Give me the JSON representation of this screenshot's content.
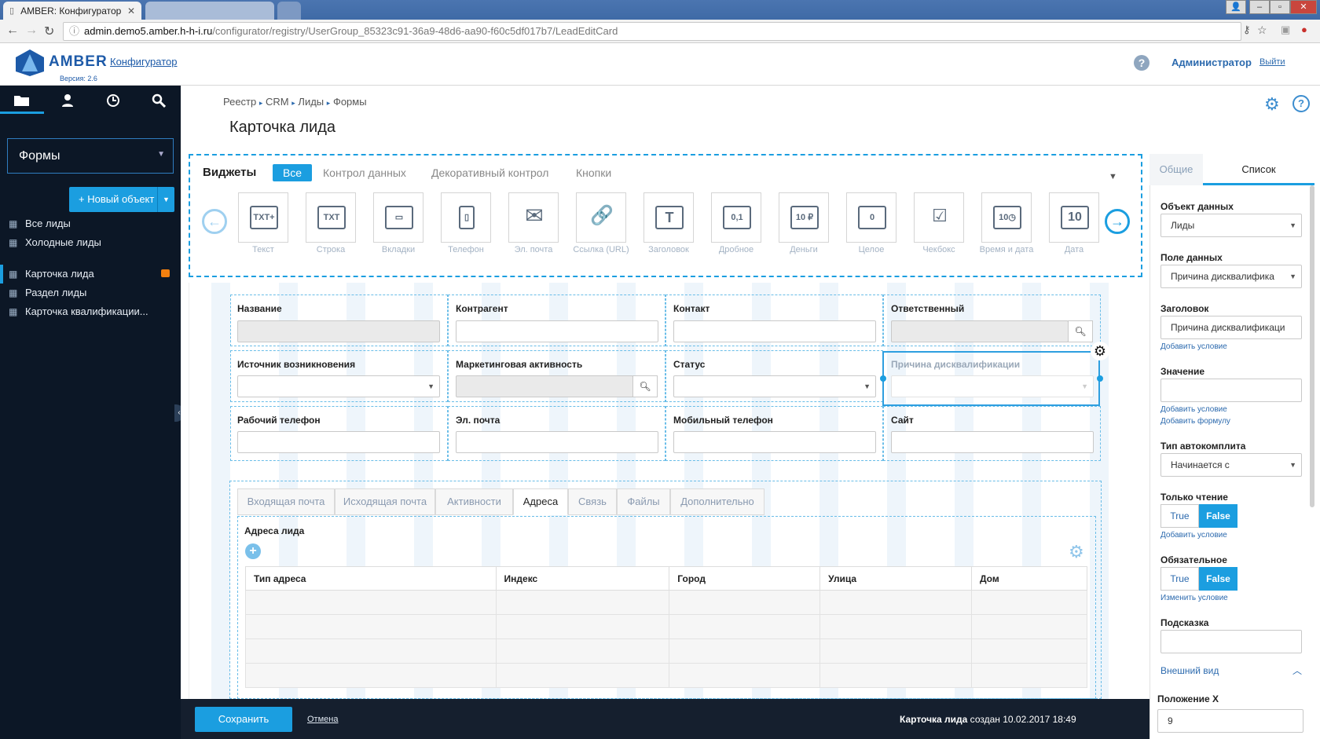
{
  "browser": {
    "tab_title": "AMBER: Конфигуратор",
    "url_host": "admin.demo5.amber.h-h-i.ru",
    "url_path": "/configurator/registry/UserGroup_85323c91-36a9-48d6-aa90-f60c5df017b7/LeadEditCard"
  },
  "header": {
    "logo_text": "AMBER",
    "version": "Версия: 2.6",
    "configurator": "Конфигуратор",
    "user": "Администратор",
    "logout": "Выйти"
  },
  "sidebar": {
    "selected": "Формы",
    "new_object": "+ Новый объект",
    "items": [
      {
        "label": "Все лиды"
      },
      {
        "label": "Холодные лиды"
      },
      {
        "label": "Карточка лида"
      },
      {
        "label": "Раздел лиды"
      },
      {
        "label": "Карточка квалификации..."
      }
    ]
  },
  "breadcrumb": [
    "Реестр",
    "CRM",
    "Лиды",
    "Формы"
  ],
  "page_title": "Карточка лида",
  "widgets": {
    "title": "Виджеты",
    "tabs": [
      "Все",
      "Контрол данных",
      "Декоративный контрол",
      "Кнопки"
    ],
    "items": [
      {
        "label": "Текст",
        "glyph": "TXT+"
      },
      {
        "label": "Строка",
        "glyph": "TXT"
      },
      {
        "label": "Вкладки",
        "glyph": "▭"
      },
      {
        "label": "Телефон",
        "glyph": "▯"
      },
      {
        "label": "Эл. почта",
        "glyph": "✉"
      },
      {
        "label": "Ссылка (URL)",
        "glyph": "🔗"
      },
      {
        "label": "Заголовок",
        "glyph": "T"
      },
      {
        "label": "Дробное",
        "glyph": "0,1"
      },
      {
        "label": "Деньги",
        "glyph": "10 ₽"
      },
      {
        "label": "Целое",
        "glyph": "0"
      },
      {
        "label": "Чекбокс",
        "glyph": "☑"
      },
      {
        "label": "Время и дата",
        "glyph": "10◷"
      },
      {
        "label": "Дата",
        "glyph": "10"
      }
    ]
  },
  "form": {
    "row1": [
      "Название",
      "Контрагент",
      "Контакт",
      "Ответственный"
    ],
    "row2": [
      "Источник возникновения",
      "Маркетинговая активность",
      "Статус",
      "Причина дисквалификации"
    ],
    "row3": [
      "Рабочий телефон",
      "Эл. почта",
      "Мобильный телефон",
      "Сайт"
    ]
  },
  "tabs": {
    "items": [
      "Входящая почта",
      "Исходящая почта",
      "Активности",
      "Адреса",
      "Связь",
      "Файлы",
      "Дополнительно"
    ],
    "section_title": "Адреса лида",
    "columns": [
      "Тип адреса",
      "Индекс",
      "Город",
      "Улица",
      "Дом"
    ]
  },
  "right_panel": {
    "tab_general": "Общие",
    "tab_list": "Список",
    "data_object_label": "Объект данных",
    "data_object_value": "Лиды",
    "data_field_label": "Поле данных",
    "data_field_value": "Причина дисквалифика",
    "heading_label": "Заголовок",
    "heading_value": "Причина дисквалификаци",
    "add_condition": "Добавить условие",
    "value_label": "Значение",
    "add_formula": "Добавить формулу",
    "autocomplete_label": "Тип автокомплита",
    "autocomplete_value": "Начинается с",
    "readonly_label": "Только чтение",
    "required_label": "Обязательное",
    "change_condition": "Изменить условие",
    "true_label": "True",
    "false_label": "False",
    "hint_label": "Подсказка",
    "appearance": "Внешний вид",
    "posx_label": "Положение X",
    "posx_value": "9"
  },
  "footer": {
    "save": "Сохранить",
    "cancel": "Отмена",
    "created_name": "Карточка лида",
    "created_text": " создан 10.02.2017 18:49"
  },
  "colors": {
    "accent": "#1b9ee0",
    "sidebar": "#0c1726",
    "brand": "#1d5aa8"
  }
}
